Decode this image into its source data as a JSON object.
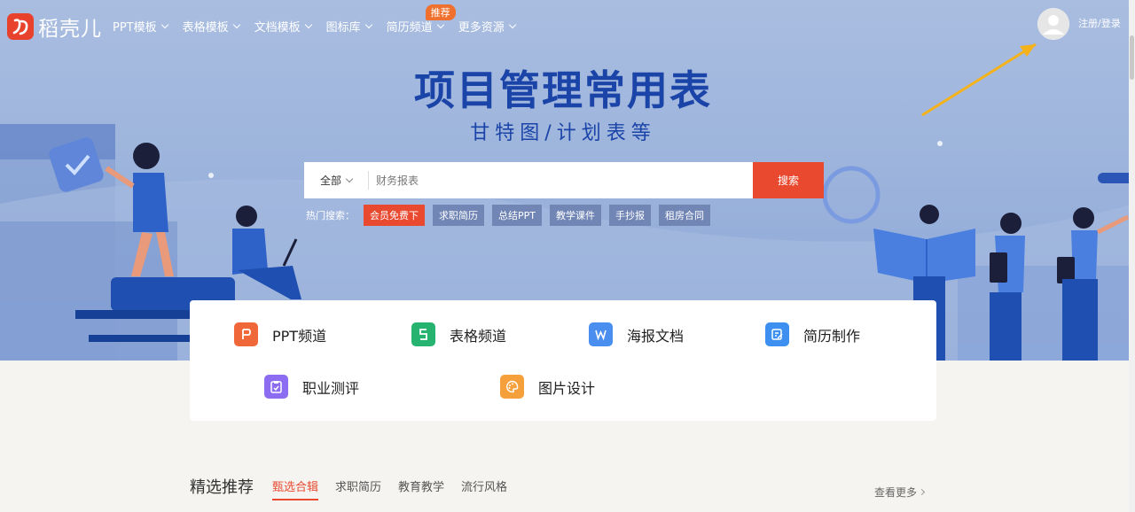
{
  "brand": {
    "name": "稻壳儿"
  },
  "nav": {
    "items": [
      {
        "label": "PPT模板"
      },
      {
        "label": "表格模板"
      },
      {
        "label": "文档模板"
      },
      {
        "label": "图标库"
      },
      {
        "label": "简历频道",
        "badge": "推荐"
      },
      {
        "label": "更多资源"
      }
    ],
    "login": "注册/登录"
  },
  "hero": {
    "title": "项目管理常用表",
    "subtitle": "甘特图/计划表等"
  },
  "search": {
    "category": "全部",
    "placeholder": "财务报表",
    "button": "搜索",
    "hot_label": "热门搜索：",
    "hot_tags": [
      "会员免费下",
      "求职简历",
      "总结PPT",
      "教学课件",
      "手抄报",
      "租房合同"
    ]
  },
  "channels": [
    {
      "label": "PPT频道",
      "icon": "ppt-icon",
      "color": "#f0683a"
    },
    {
      "label": "表格频道",
      "icon": "sheet-icon",
      "color": "#25b36f"
    },
    {
      "label": "海报文档",
      "icon": "word-icon",
      "color": "#4a8ef0"
    },
    {
      "label": "简历制作",
      "icon": "resume-icon",
      "color": "#3d8ff0"
    },
    {
      "label": "职业测评",
      "icon": "clipboard-icon",
      "color": "#8c6cf0"
    },
    {
      "label": "图片设计",
      "icon": "palette-icon",
      "color": "#f5a03a"
    }
  ],
  "recommend": {
    "title": "精选推荐",
    "tabs": [
      "甄选合辑",
      "求职简历",
      "教育教学",
      "流行风格"
    ],
    "active_tab": "甄选合辑",
    "more": "查看更多"
  },
  "colors": {
    "accent": "#e8492f",
    "hero_title": "#1b44a8"
  }
}
